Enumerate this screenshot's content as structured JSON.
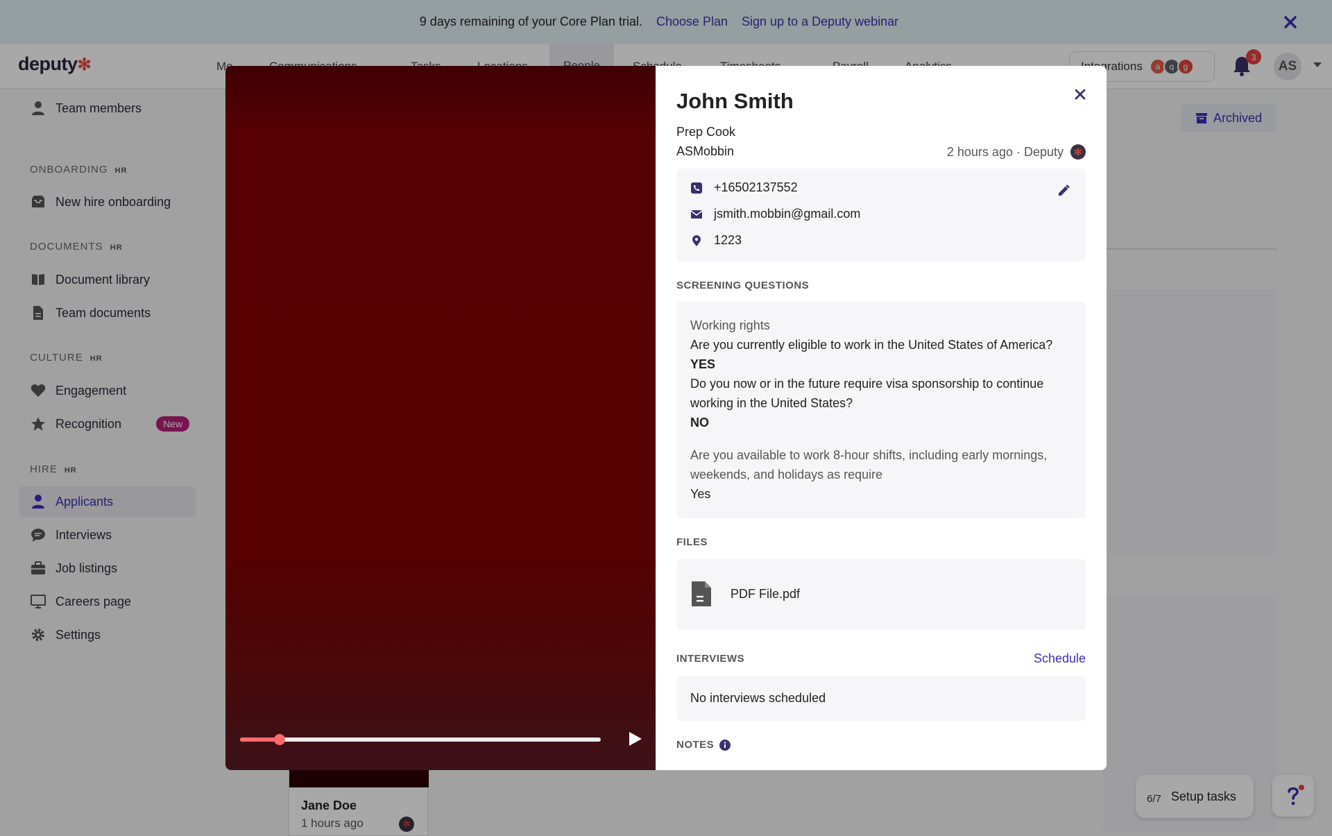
{
  "banner": {
    "trial_text": "9 days remaining of your Core Plan trial.",
    "choose_plan": "Choose Plan",
    "webinar": "Sign up to a Deputy webinar"
  },
  "nav": {
    "logo": "deputy",
    "items": [
      "Me",
      "Communications",
      "Tasks",
      "Locations",
      "People",
      "Schedule",
      "Timesheets",
      "Payroll",
      "Analytics"
    ],
    "active": "People",
    "integrations": "Integrations",
    "notification_count": "3",
    "avatar_initials": "AS"
  },
  "sidebar": {
    "team_members": "Team members",
    "sections": [
      {
        "title": "ONBOARDING",
        "tag": "HR",
        "items": [
          "New hire onboarding"
        ]
      },
      {
        "title": "DOCUMENTS",
        "tag": "HR",
        "items": [
          "Document library",
          "Team documents"
        ]
      },
      {
        "title": "CULTURE",
        "tag": "HR",
        "items": [
          "Engagement",
          "Recognition"
        ]
      },
      {
        "title": "HIRE",
        "tag": "HR",
        "items": [
          "Applicants",
          "Interviews",
          "Job listings",
          "Careers page",
          "Settings"
        ]
      }
    ],
    "new_badge": "New",
    "active_item": "Applicants"
  },
  "background": {
    "archived": "Archived",
    "applicant_card": {
      "name": "Jane Doe",
      "time": "1 hours ago"
    }
  },
  "setup_tasks": {
    "progress": "6/7",
    "label": "Setup tasks"
  },
  "video": {
    "progress_fraction": 0.11
  },
  "profile": {
    "name": "John Smith",
    "role": "Prep Cook",
    "username": "ASMobbin",
    "meta": "2 hours ago · Deputy",
    "phone": "+16502137552",
    "email": "jsmith.mobbin@gmail.com",
    "location": "1223"
  },
  "screening": {
    "heading": "SCREENING QUESTIONS",
    "category": "Working rights",
    "q1": "Are you currently eligible to work in the United States of America?",
    "a1": "YES",
    "q2": "Do you now or in the future require visa sponsorship to continue working in the United States?",
    "a2": "NO",
    "q3": "Are you available to work 8-hour shifts, including early mornings, weekends, and holidays as require",
    "a3": "Yes"
  },
  "files": {
    "heading": "FILES",
    "file_name": "PDF File.pdf"
  },
  "interviews": {
    "heading": "INTERVIEWS",
    "schedule": "Schedule",
    "empty": "No interviews scheduled"
  },
  "notes": {
    "heading": "NOTES"
  },
  "colors": {
    "accent": "#3b2fb5",
    "brand_red": "#e8463a",
    "new_badge": "#b3207a",
    "video_bg": "#560000",
    "scrubber": "#ff6b6b"
  }
}
